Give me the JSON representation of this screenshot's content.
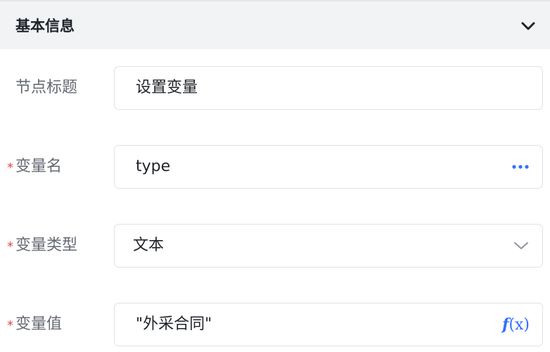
{
  "section": {
    "title": "基本信息",
    "collapse_icon": "chevron-down-icon"
  },
  "fields": {
    "node_title": {
      "label": "节点标题",
      "value": "设置变量",
      "required": false
    },
    "variable_name": {
      "label": "变量名",
      "value": "type",
      "required": true,
      "suffix_icon": "more-icon"
    },
    "variable_type": {
      "label": "变量类型",
      "value": "文本",
      "required": true,
      "suffix_icon": "chevron-down-icon"
    },
    "variable_value": {
      "label": "变量值",
      "value": "\"外采合同\"",
      "required": true,
      "suffix_icon": "function-icon",
      "suffix_text": "f(x)"
    }
  },
  "required_mark": "*",
  "colors": {
    "header_bg": "#f2f3f5",
    "label": "#646a73",
    "text": "#1f2329",
    "accent": "#3370ff",
    "required": "#e5484d",
    "border": "#dfe1e5"
  }
}
